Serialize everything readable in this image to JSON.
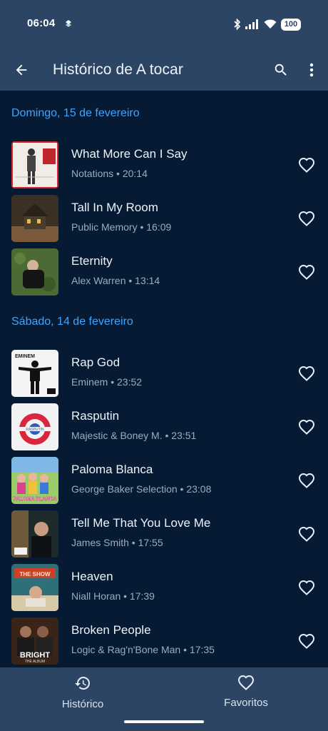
{
  "status_bar": {
    "time": "06:04",
    "battery": "100"
  },
  "app_bar": {
    "title": "Histórico de A tocar"
  },
  "sections": [
    {
      "header": "Domingo, 15 de fevereiro"
    },
    {
      "header": "Sábado, 14 de fevereiro"
    }
  ],
  "songs": [
    {
      "title": "What More Can I Say",
      "meta": "Notations • 20:14"
    },
    {
      "title": "Tall In My Room",
      "meta": "Public Memory • 16:09"
    },
    {
      "title": "Eternity",
      "meta": "Alex Warren • 13:14"
    },
    {
      "title": "Rap God",
      "meta": "Eminem • 23:52"
    },
    {
      "title": "Rasputin",
      "meta": "Majestic & Boney M. • 23:51"
    },
    {
      "title": "Paloma Blanca",
      "meta": "George Baker Selection • 23:08"
    },
    {
      "title": "Tell Me That You Love Me",
      "meta": "James Smith • 17:55"
    },
    {
      "title": "Heaven",
      "meta": "Niall Horan • 17:39"
    },
    {
      "title": "Broken People",
      "meta": "Logic & Rag'n'Bone Man • 17:35"
    }
  ],
  "cover_text": {
    "eminem": "EMINEM",
    "bright": "BRIGHT",
    "bright_sub": "THE ALBUM",
    "paloma": "PALOMA BLANCA",
    "heaven": "THE SHOW",
    "rasputin": "RASPUTIN"
  },
  "bottom_nav": {
    "history": "Histórico",
    "favorites": "Favoritos"
  },
  "colors": {
    "accent": "#3ea5ff",
    "bar": "#2d4564",
    "background": "#061a33"
  }
}
